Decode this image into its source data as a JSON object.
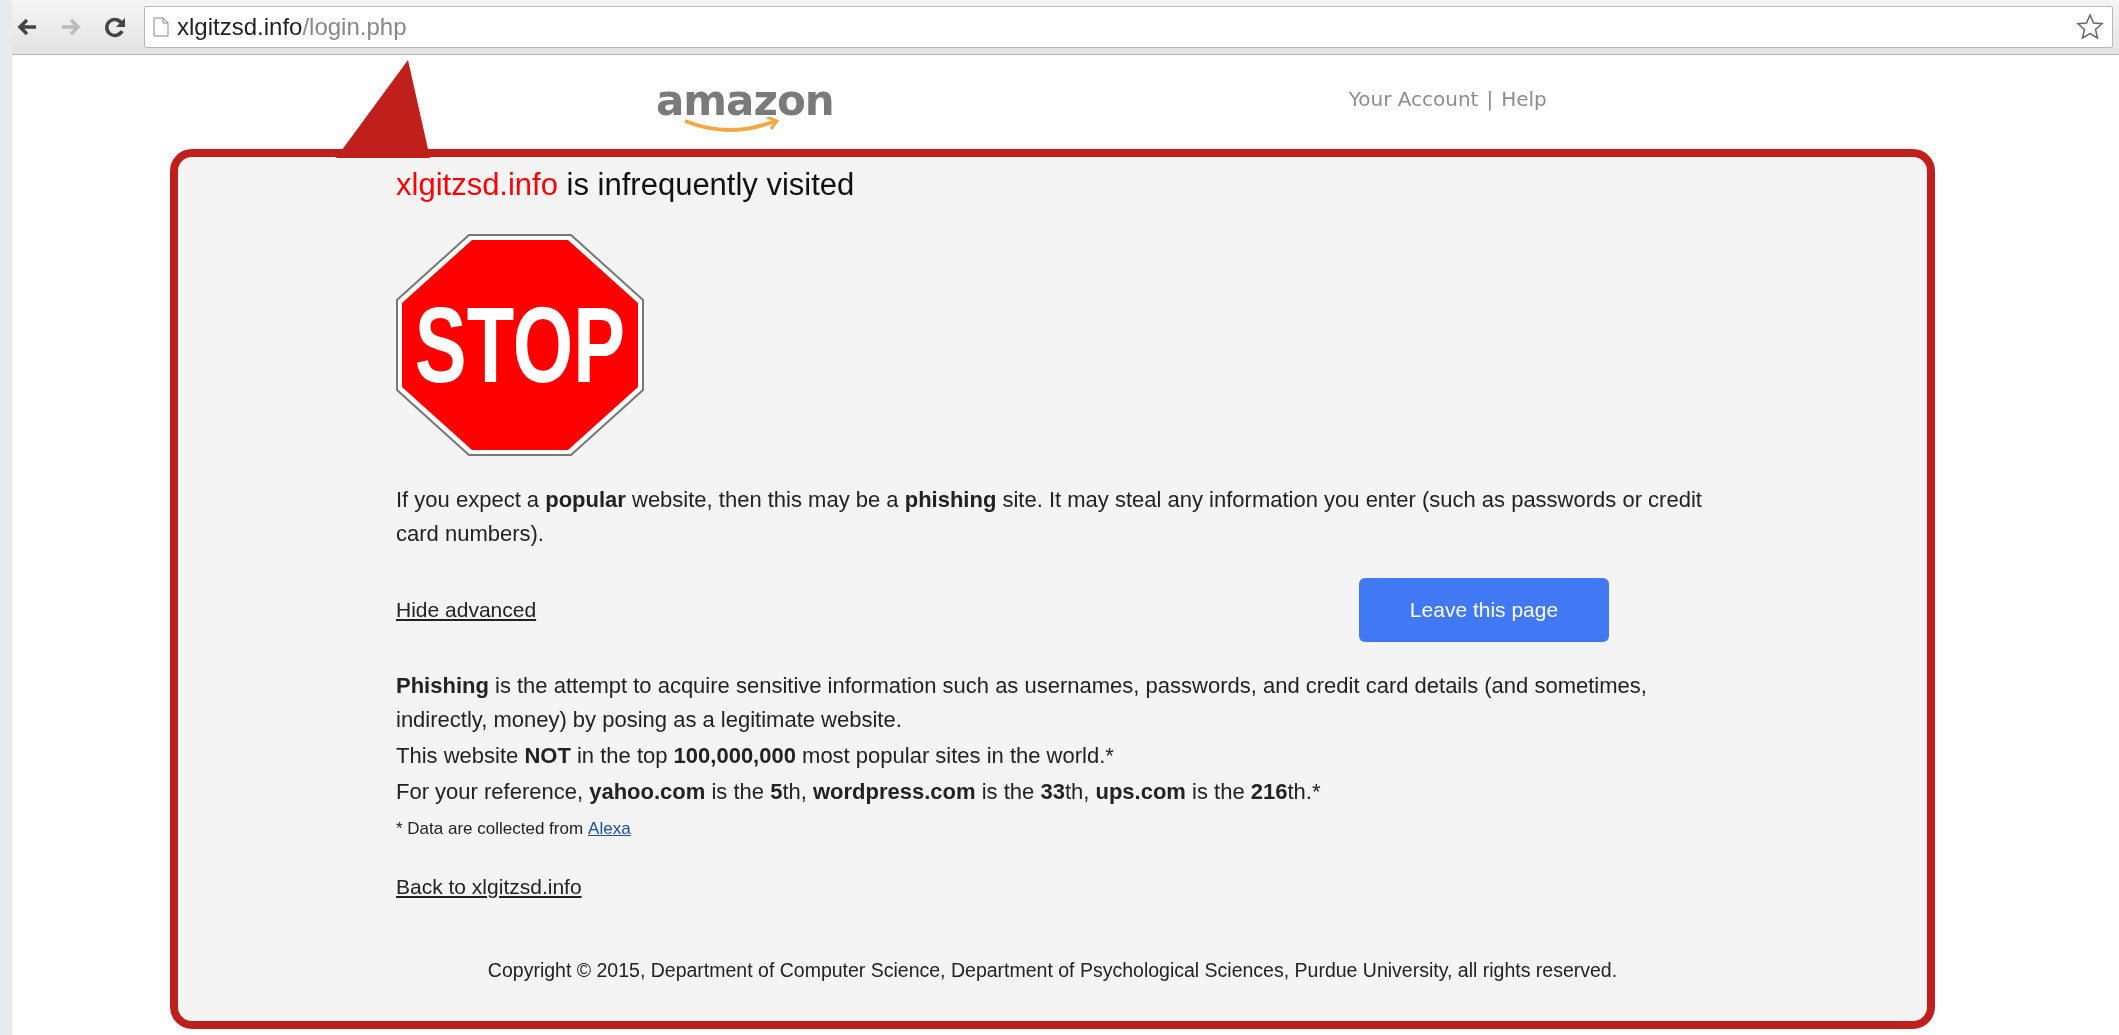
{
  "browser": {
    "url_domain": "xlgitzsd.info",
    "url_path": "/login.php"
  },
  "site_header": {
    "logo": "amazon",
    "links": [
      "Your Account",
      "Help"
    ],
    "separator": "|"
  },
  "warning": {
    "domain": "xlgitzsd.info",
    "title_rest": "is infrequently visited",
    "sign": "STOP",
    "intro": "If you expect a **popular** website, then this may be a **phishing** site. It may steal any information you enter (such as passwords or credit card numbers).",
    "advanced_link": "Hide advanced",
    "leave_button": "Leave this page",
    "details": [
      "**Phishing** is the attempt to acquire sensitive information such as usernames, passwords, and credit card details (and sometimes, indirectly, money) by posing as a legitimate website.",
      "This website **NOT** in the top **100,000,000** most popular sites in the world.*",
      "For your reference, **yahoo.com** is the **5**th, **wordpress.com** is the **33**th, **ups.com** is the **216**th.*"
    ],
    "footnote": "* Data are collected from",
    "footnote_link": "Alexa",
    "back_link": "Back to xlgitzsd.info",
    "copyright": "Copyright © 2015, Department of Computer Science, Department of Psychological Sciences, Purdue University, all rights reserved."
  }
}
